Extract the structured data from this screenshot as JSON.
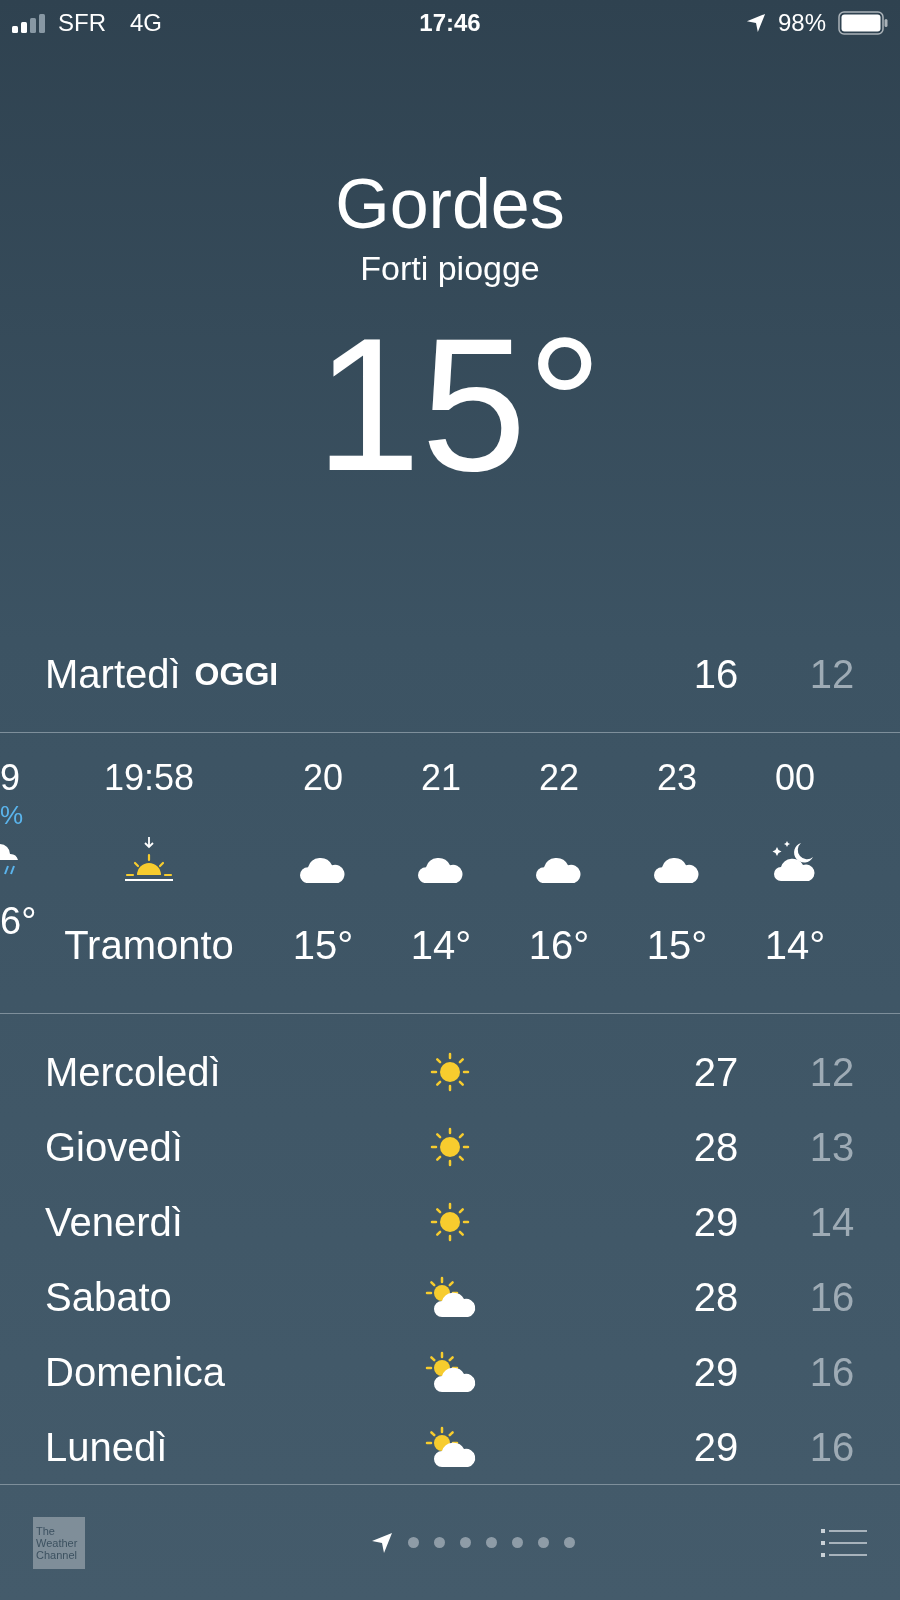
{
  "status_bar": {
    "carrier": "SFR",
    "network": "4G",
    "time": "17:46",
    "battery": "98%"
  },
  "location": {
    "city": "Gordes",
    "condition": "Forti piogge",
    "temperature": "15°"
  },
  "today": {
    "day": "Martedì",
    "label": "OGGI",
    "high": "16",
    "low": "12"
  },
  "hourly": [
    {
      "kind": "rain",
      "time": "9",
      "chance": "%",
      "temp": "6°"
    },
    {
      "kind": "sunset",
      "time": "19:58",
      "temp": "Tramonto"
    },
    {
      "kind": "cloud",
      "time": "20",
      "temp": "15°"
    },
    {
      "kind": "cloud",
      "time": "21",
      "temp": "14°"
    },
    {
      "kind": "cloud",
      "time": "22",
      "temp": "16°"
    },
    {
      "kind": "cloud",
      "time": "23",
      "temp": "15°"
    },
    {
      "kind": "night",
      "time": "00",
      "temp": "14°"
    }
  ],
  "daily": [
    {
      "day": "Mercoledì",
      "kind": "sun",
      "high": "27",
      "low": "12"
    },
    {
      "day": "Giovedì",
      "kind": "sun",
      "high": "28",
      "low": "13"
    },
    {
      "day": "Venerdì",
      "kind": "sun",
      "high": "29",
      "low": "14"
    },
    {
      "day": "Sabato",
      "kind": "partly",
      "high": "28",
      "low": "16"
    },
    {
      "day": "Domenica",
      "kind": "partly",
      "high": "29",
      "low": "16"
    },
    {
      "day": "Lunedì",
      "kind": "partly",
      "high": "29",
      "low": "16"
    }
  ],
  "pages": [
    {
      "kind": "location",
      "selected": true
    },
    {
      "kind": "dot",
      "selected": false
    },
    {
      "kind": "dot",
      "selected": false
    },
    {
      "kind": "dot",
      "selected": false
    },
    {
      "kind": "dot",
      "selected": false
    },
    {
      "kind": "dot",
      "selected": false
    },
    {
      "kind": "dot",
      "selected": false
    },
    {
      "kind": "dot",
      "selected": false
    }
  ],
  "logo": [
    "The",
    "Weather",
    "Channel"
  ]
}
